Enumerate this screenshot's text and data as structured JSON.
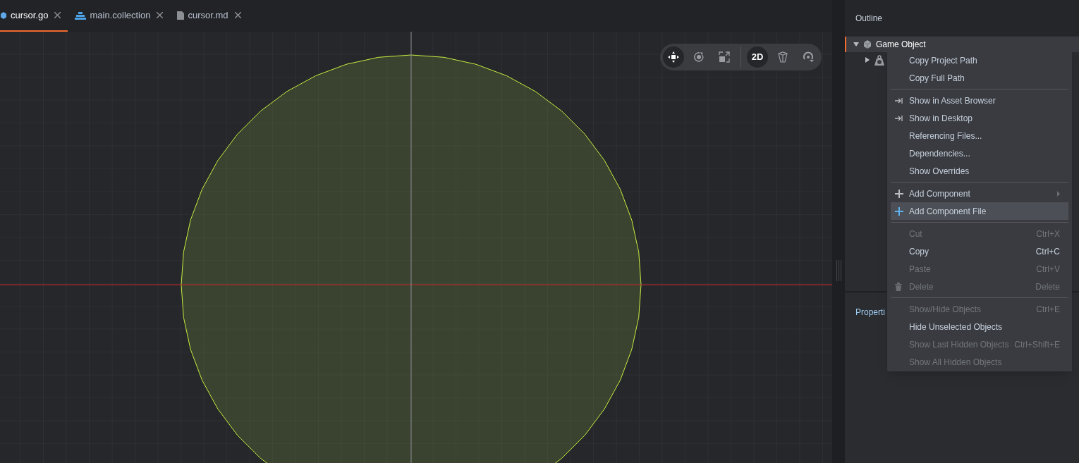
{
  "tabs": [
    {
      "label": "cursor.go",
      "kind": "gameobject",
      "selected": true
    },
    {
      "label": "main.collection",
      "kind": "collection",
      "selected": false
    },
    {
      "label": "cursor.md",
      "kind": "file",
      "selected": false
    }
  ],
  "toolbar": [
    {
      "kind": "move",
      "selected": true
    },
    {
      "kind": "rotate",
      "selected": false
    },
    {
      "kind": "scale",
      "selected": false
    },
    {
      "kind": "divider"
    },
    {
      "kind": "text",
      "label": "2D",
      "selected": true
    },
    {
      "kind": "perspective",
      "selected": false
    },
    {
      "kind": "reset",
      "selected": false
    }
  ],
  "outline": {
    "title": "Outline",
    "tree": [
      {
        "label": "Game Object",
        "expanded": true,
        "selected": true,
        "children": [
          {
            "expanded": false
          }
        ]
      }
    ]
  },
  "properties": {
    "title": "Properti"
  },
  "context_menu": [
    {
      "kind": "item",
      "label": "Copy Project Path",
      "disabled": false,
      "selected": false
    },
    {
      "kind": "item",
      "label": "Copy Full Path",
      "disabled": false,
      "selected": false
    },
    {
      "kind": "separator"
    },
    {
      "kind": "reveal",
      "label": "Show in Asset Browser",
      "disabled": false,
      "selected": false
    },
    {
      "kind": "reveal",
      "label": "Show in Desktop",
      "disabled": false,
      "selected": false
    },
    {
      "kind": "item",
      "label": "Referencing Files...",
      "disabled": false,
      "selected": false
    },
    {
      "kind": "item",
      "label": "Dependencies...",
      "disabled": false,
      "selected": false
    },
    {
      "kind": "item",
      "label": "Show Overrides",
      "disabled": false,
      "selected": false
    },
    {
      "kind": "separator"
    },
    {
      "kind": "add",
      "label": "Add Component",
      "submenu": true,
      "disabled": false,
      "selected": false
    },
    {
      "kind": "add",
      "label": "Add Component File",
      "disabled": false,
      "selected": true
    },
    {
      "kind": "separator"
    },
    {
      "kind": "item",
      "label": "Cut",
      "shortcut": "Ctrl+X",
      "disabled": true,
      "selected": false
    },
    {
      "kind": "item",
      "label": "Copy",
      "shortcut": "Ctrl+C",
      "disabled": false,
      "selected": false
    },
    {
      "kind": "item",
      "label": "Paste",
      "shortcut": "Ctrl+V",
      "disabled": true,
      "selected": false
    },
    {
      "kind": "delete",
      "label": "Delete",
      "shortcut": "Delete",
      "disabled": true,
      "selected": false
    },
    {
      "kind": "separator"
    },
    {
      "kind": "item",
      "label": "Show/Hide Objects",
      "shortcut": "Ctrl+E",
      "disabled": true,
      "selected": false
    },
    {
      "kind": "item",
      "label": "Hide Unselected Objects",
      "disabled": false,
      "selected": false
    },
    {
      "kind": "item",
      "label": "Show Last Hidden Objects",
      "shortcut": "Ctrl+Shift+E",
      "disabled": true,
      "selected": false
    },
    {
      "kind": "item",
      "label": "Show All Hidden Objects",
      "disabled": true,
      "selected": false
    }
  ]
}
